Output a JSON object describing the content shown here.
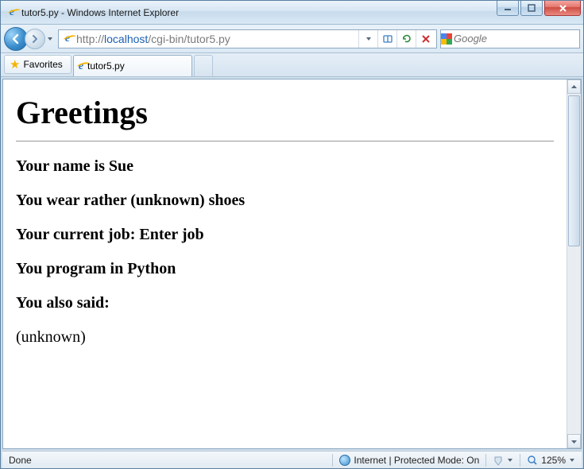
{
  "window": {
    "title": "tutor5.py - Windows Internet Explorer"
  },
  "address": {
    "protocol": "http://",
    "host": "localhost",
    "path": "/cgi-bin/tutor5.py"
  },
  "search": {
    "placeholder": "Google"
  },
  "favorites": {
    "label": "Favorites"
  },
  "tab": {
    "label": "tutor5.py"
  },
  "page": {
    "heading": "Greetings",
    "lines": {
      "name": "Your name is Sue",
      "shoes": "You wear rather (unknown) shoes",
      "job": "Your current job: Enter job",
      "lang": "You program in Python",
      "also": "You also said:",
      "unknown": "(unknown)"
    }
  },
  "status": {
    "left": "Done",
    "zone": "Internet | Protected Mode: On",
    "zoom": "125%"
  }
}
